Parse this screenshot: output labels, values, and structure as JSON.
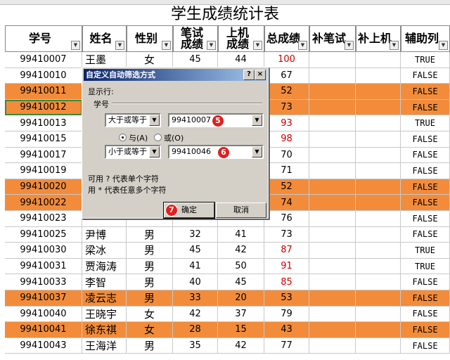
{
  "sheet": {
    "title": "学生成绩统计表",
    "headers": [
      "学号",
      "姓名",
      "性别",
      "笔试成绩",
      "上机成绩",
      "总成绩",
      "补笔试",
      "补上机",
      "辅助列"
    ],
    "rows": [
      {
        "id": "99410007",
        "name": "王墨",
        "sex": "女",
        "written": "45",
        "lab": "44",
        "total": "100",
        "aux": "TRUE",
        "hl": false
      },
      {
        "id": "99410010",
        "name": "",
        "sex": "",
        "written": "",
        "lab": "",
        "total": "67",
        "aux": "FALSE",
        "hl": false
      },
      {
        "id": "99410011",
        "name": "",
        "sex": "",
        "written": "",
        "lab": "",
        "total": "52",
        "aux": "FALSE",
        "hl": true
      },
      {
        "id": "99410012",
        "name": "",
        "sex": "",
        "written": "",
        "lab": "",
        "total": "73",
        "aux": "FALSE",
        "hl": true
      },
      {
        "id": "99410013",
        "name": "",
        "sex": "",
        "written": "",
        "lab": "",
        "total": "93",
        "aux": "TRUE",
        "hl": false
      },
      {
        "id": "99410015",
        "name": "",
        "sex": "",
        "written": "",
        "lab": "",
        "total": "98",
        "aux": "FALSE",
        "hl": false
      },
      {
        "id": "99410017",
        "name": "",
        "sex": "",
        "written": "",
        "lab": "",
        "total": "70",
        "aux": "FALSE",
        "hl": false
      },
      {
        "id": "99410019",
        "name": "",
        "sex": "",
        "written": "",
        "lab": "",
        "total": "71",
        "aux": "FALSE",
        "hl": false
      },
      {
        "id": "99410020",
        "name": "",
        "sex": "",
        "written": "",
        "lab": "",
        "total": "52",
        "aux": "FALSE",
        "hl": true
      },
      {
        "id": "99410022",
        "name": "",
        "sex": "",
        "written": "",
        "lab": "",
        "total": "74",
        "aux": "FALSE",
        "hl": true
      },
      {
        "id": "99410023",
        "name": "",
        "sex": "",
        "written": "",
        "lab": "",
        "total": "76",
        "aux": "FALSE",
        "hl": false
      },
      {
        "id": "99410025",
        "name": "尹博",
        "sex": "男",
        "written": "32",
        "lab": "41",
        "total": "73",
        "aux": "FALSE",
        "hl": false
      },
      {
        "id": "99410030",
        "name": "梁冰",
        "sex": "男",
        "written": "45",
        "lab": "42",
        "total": "87",
        "aux": "TRUE",
        "hl": false
      },
      {
        "id": "99410031",
        "name": "贾海涛",
        "sex": "男",
        "written": "41",
        "lab": "50",
        "total": "91",
        "aux": "TRUE",
        "hl": false
      },
      {
        "id": "99410033",
        "name": "李智",
        "sex": "男",
        "written": "40",
        "lab": "45",
        "total": "85",
        "aux": "FALSE",
        "hl": false
      },
      {
        "id": "99410037",
        "name": "凌云志",
        "sex": "男",
        "written": "33",
        "lab": "20",
        "total": "53",
        "aux": "FALSE",
        "hl": true
      },
      {
        "id": "99410040",
        "name": "王晓宇",
        "sex": "女",
        "written": "42",
        "lab": "37",
        "total": "79",
        "aux": "FALSE",
        "hl": false
      },
      {
        "id": "99410041",
        "name": "徐东祺",
        "sex": "女",
        "written": "28",
        "lab": "15",
        "total": "43",
        "aux": "FALSE",
        "hl": true
      },
      {
        "id": "99410043",
        "name": "王海洋",
        "sex": "男",
        "written": "35",
        "lab": "42",
        "total": "77",
        "aux": "FALSE",
        "hl": false
      }
    ]
  },
  "dialog": {
    "title": "自定义自动筛选方式",
    "help_btn": "?",
    "close_btn": "×",
    "show_rows": "显示行:",
    "field": "学号",
    "op1": "大于或等于",
    "val1": "99410007",
    "and_label": "与(A)",
    "or_label": "或(O)",
    "op2": "小于或等于",
    "val2": "99410046",
    "hint1": "可用 ? 代表单个字符",
    "hint2": "用 * 代表任意多个字符",
    "ok": "确定",
    "cancel": "取消"
  },
  "badges": {
    "b5": "5",
    "b6": "6",
    "b7": "7"
  },
  "colors": {
    "highlight": "#f28c3a",
    "red_text": "#cc0000",
    "title_bar": "#0a246a"
  }
}
